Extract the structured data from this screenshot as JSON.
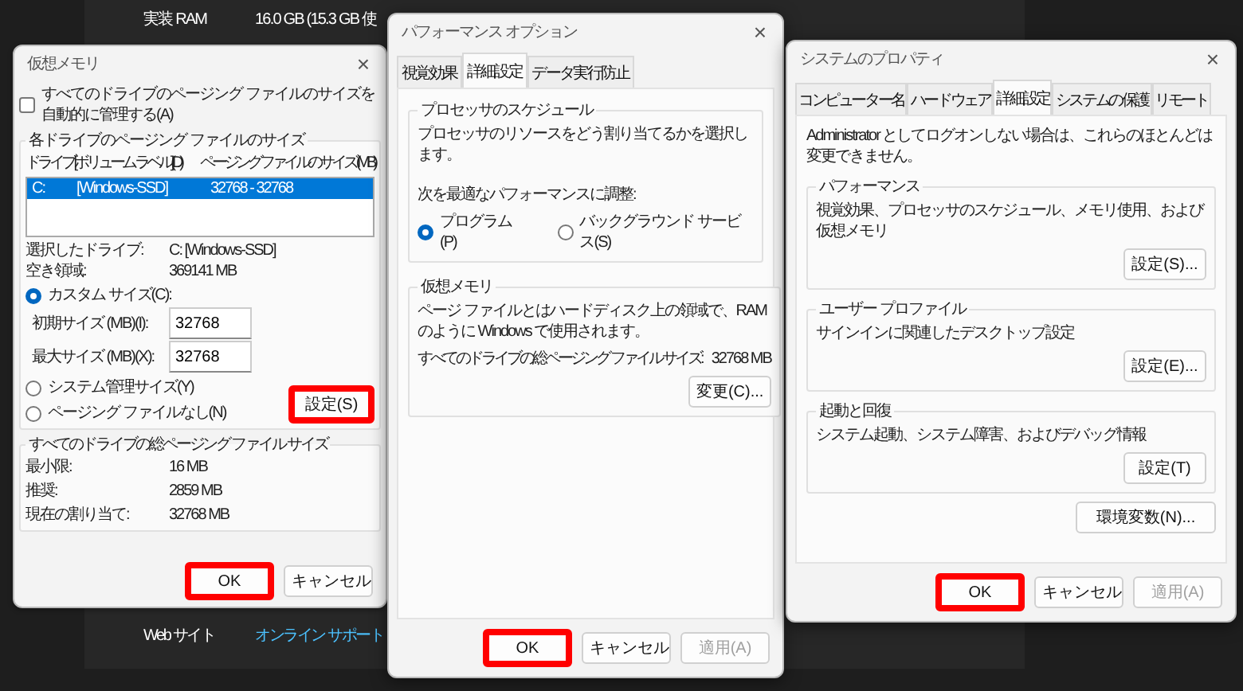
{
  "background": {
    "specs": [
      {
        "label": "実装 RAM",
        "value": "16.0 GB (15.3 GB 使"
      }
    ],
    "links": [
      {
        "label": "Web サイト",
        "link": "オンライン サポート"
      }
    ]
  },
  "virtual_memory": {
    "title": "仮想メモリ",
    "close": "×",
    "auto_manage": {
      "label": "すべてのドライブのページング ファイルのサイズを自動的に管理する(A)",
      "checked": false
    },
    "drives_group": {
      "title": "各ドライブのページング ファイルのサイズ",
      "columns": [
        "ドライブ [ボリューム ラベル](D)",
        "ページング ファイルのサイズ (MB)"
      ],
      "rows": [
        {
          "drive": "C:",
          "label": "[Windows-SSD]",
          "size": "32768 - 32768",
          "selected": true
        }
      ],
      "info": [
        {
          "label": "選択したドライブ:",
          "value": "C: [Windows-SSD]"
        },
        {
          "label": "空き領域:",
          "value": "369141 MB"
        }
      ],
      "options": [
        {
          "label": "カスタム サイズ(C):",
          "selected": true,
          "fields": [
            {
              "label": "初期サイズ (MB)(I):",
              "value": "32768"
            },
            {
              "label": "最大サイズ (MB)(X):",
              "value": "32768"
            }
          ]
        },
        {
          "label": "システム管理サイズ(Y)",
          "selected": false
        },
        {
          "label": "ページング ファイルなし(N)",
          "selected": false
        }
      ],
      "set_button": {
        "label": "設定(S)",
        "highlighted": true,
        "disabled": false
      }
    },
    "totals_group": {
      "title": "すべてのドライブの総ページング ファイル サイズ",
      "rows": [
        {
          "label": "最小限:",
          "value": "16 MB"
        },
        {
          "label": "推奨:",
          "value": "2859 MB"
        },
        {
          "label": "現在の割り当て:",
          "value": "32768 MB"
        }
      ]
    },
    "buttons": [
      {
        "label": "OK",
        "highlighted": true,
        "disabled": false
      },
      {
        "label": "キャンセル",
        "highlighted": false,
        "disabled": false
      }
    ]
  },
  "performance_options": {
    "title": "パフォーマンス オプション",
    "close": "×",
    "tabs": [
      {
        "label": "視覚効果",
        "selected": false
      },
      {
        "label": "詳細設定",
        "selected": true
      },
      {
        "label": "データ実行防止",
        "selected": false
      }
    ],
    "scheduling_group": {
      "title": "プロセッサのスケジュール",
      "description": "プロセッサのリソースをどう割り当てるかを選択します。",
      "prompt": "次を最適なパフォーマンスに調整:",
      "options": [
        {
          "label": "プログラム(P)",
          "selected": true
        },
        {
          "label": "バックグラウンド サービス(S)",
          "selected": false
        }
      ]
    },
    "memory_group": {
      "title": "仮想メモリ",
      "description": "ページ ファイルとはハードディスク上の領域で、RAM のように Windows で使用されます。",
      "total_label": "すべてのドライブの総ページング ファイル サイズ:",
      "total_value": "32768 MB",
      "button": {
        "label": "変更(C)...",
        "highlighted": false,
        "disabled": false
      }
    },
    "buttons": [
      {
        "label": "OK",
        "highlighted": true,
        "disabled": false
      },
      {
        "label": "キャンセル",
        "highlighted": false,
        "disabled": false
      },
      {
        "label": "適用(A)",
        "highlighted": false,
        "disabled": true
      }
    ]
  },
  "system_properties": {
    "title": "システムのプロパティ",
    "close": "×",
    "tabs": [
      {
        "label": "コンピューター名",
        "selected": false
      },
      {
        "label": "ハードウェア",
        "selected": false
      },
      {
        "label": "詳細設定",
        "selected": true
      },
      {
        "label": "システムの保護",
        "selected": false
      },
      {
        "label": "リモート",
        "selected": false
      }
    ],
    "note": "Administrator としてログオンしない場合は、これらのほとんどは変更できません。",
    "groups": [
      {
        "title": "パフォーマンス",
        "description": "視覚効果、プロセッサのスケジュール、メモリ使用、および仮想メモリ",
        "button": {
          "label": "設定(S)...",
          "highlighted": false,
          "disabled": false
        }
      },
      {
        "title": "ユーザー プロファイル",
        "description": "サインインに関連したデスクトップ設定",
        "button": {
          "label": "設定(E)...",
          "highlighted": false,
          "disabled": false
        }
      },
      {
        "title": "起動と回復",
        "description": "システム起動、システム障害、およびデバッグ情報",
        "button": {
          "label": "設定(T)",
          "highlighted": false,
          "disabled": false
        }
      }
    ],
    "env_button": {
      "label": "環境変数(N)...",
      "highlighted": false,
      "disabled": false
    },
    "buttons": [
      {
        "label": "OK",
        "highlighted": true,
        "disabled": false
      },
      {
        "label": "キャンセル",
        "highlighted": false,
        "disabled": false
      },
      {
        "label": "適用(A)",
        "highlighted": false,
        "disabled": true
      }
    ]
  }
}
